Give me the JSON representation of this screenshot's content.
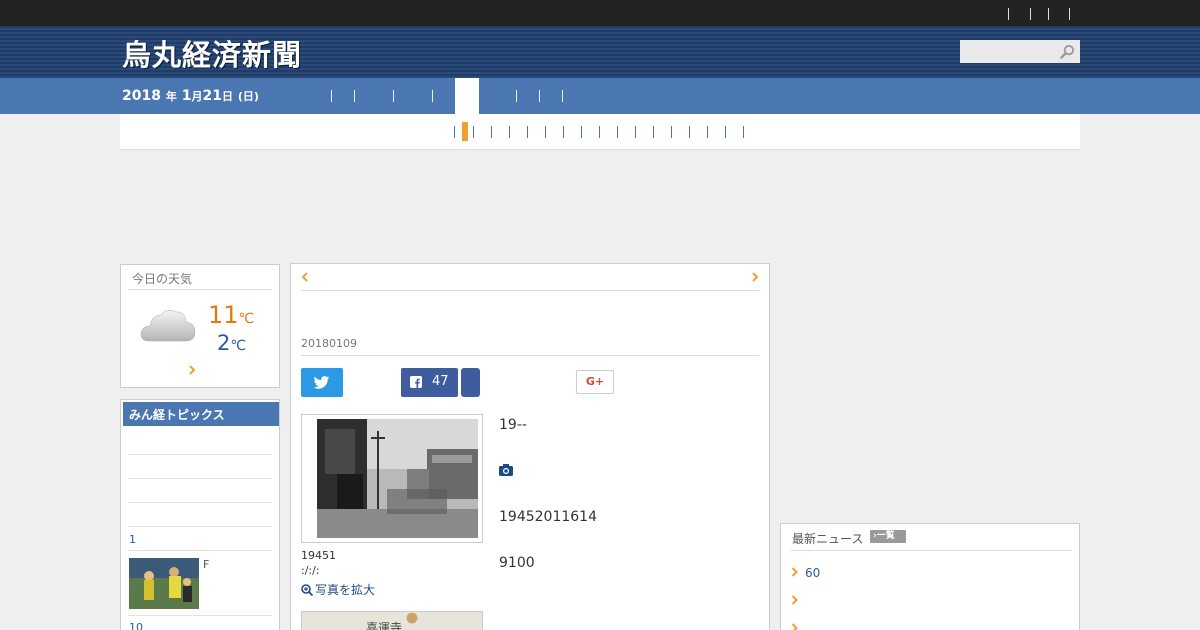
{
  "site": {
    "title": "烏丸経済新聞"
  },
  "search": {
    "placeholder": ""
  },
  "date": {
    "year": "2018",
    "y_unit": "年",
    "month": "1",
    "m_unit": "月",
    "day": "21",
    "d_unit": "日",
    "weekday": "(日)"
  },
  "weather": {
    "title": "今日の天気",
    "high": "11",
    "low": "2",
    "unit": "℃",
    "icon": "cloud-icon"
  },
  "topics": {
    "title": "みん経トピックス",
    "items": [
      {
        "num": "1"
      },
      {
        "text": "F"
      },
      {
        "num": "10"
      }
    ]
  },
  "article": {
    "date": "20180109",
    "fb_count": "47",
    "gplus_label": "G+",
    "photo_caption1": "19451",
    "photo_caption2": ":/:/:",
    "zoom_label": "写真を拡大",
    "map_label": "喜運寺",
    "body1": "19--",
    "body2": "19452011614",
    "body3": "9100"
  },
  "news": {
    "title": "最新ニュース",
    "list_button": "一覧",
    "items": [
      {
        "text": "60"
      },
      {
        "text": ""
      },
      {
        "text": ""
      }
    ]
  },
  "colors": {
    "header": "#1f3b66",
    "nav": "#4a76b2",
    "accent": "#f0a030",
    "twitter": "#2b9ae6",
    "facebook": "#3f5d9e"
  }
}
